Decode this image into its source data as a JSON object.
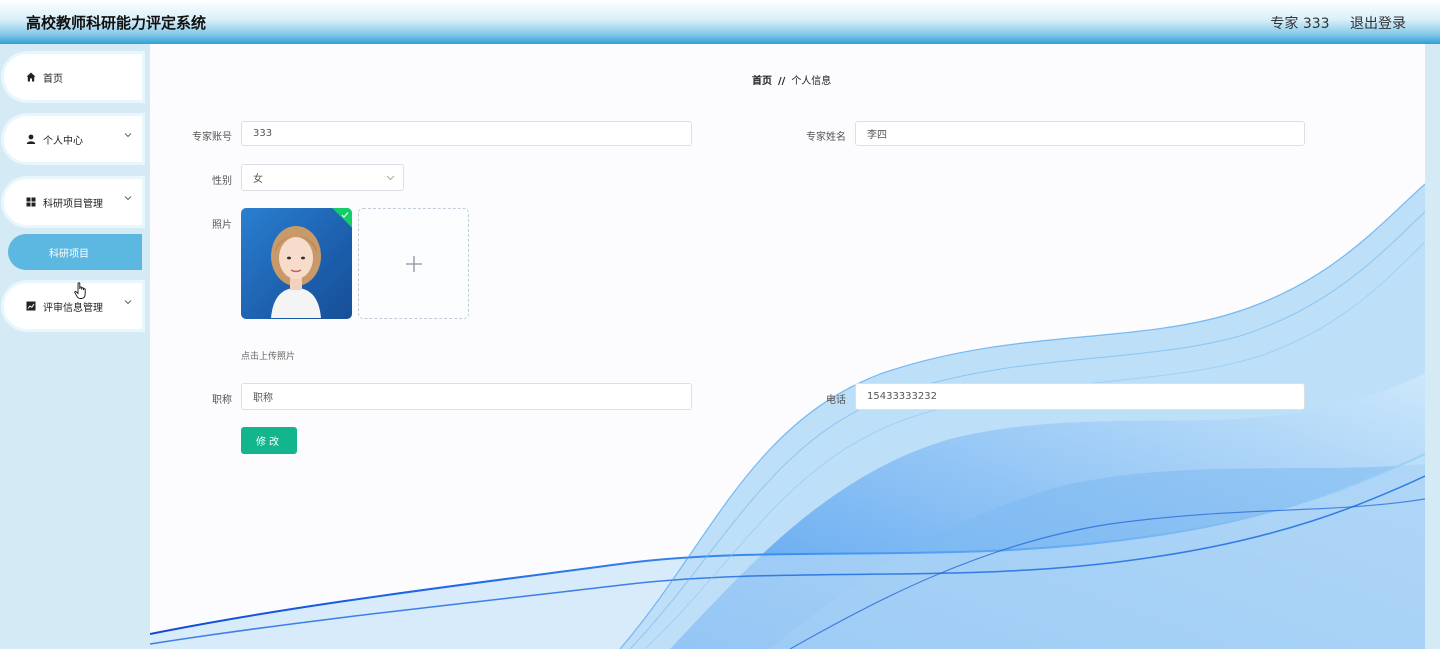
{
  "header": {
    "title": "高校教师科研能力评定系统",
    "user": "专家 333",
    "logout": "退出登录"
  },
  "sidebar": {
    "items": [
      {
        "label": "首页",
        "icon": "home-icon"
      },
      {
        "label": "个人中心",
        "icon": "user-icon"
      },
      {
        "label": "科研项目管理",
        "icon": "grid-icon"
      },
      {
        "label": "评审信息管理",
        "icon": "chart-icon"
      }
    ],
    "submenu": {
      "label": "科研项目"
    }
  },
  "breadcrumb": {
    "home": "首页",
    "separator": "//",
    "current": "个人信息"
  },
  "form": {
    "account_label": "专家账号",
    "account_value": "333",
    "name_label": "专家姓名",
    "name_value": "李四",
    "gender_label": "性别",
    "gender_value": "女",
    "photo_label": "照片",
    "upload_tip": "点击上传照片",
    "title_label": "职称",
    "title_placeholder": "职称",
    "phone_label": "电话",
    "phone_value": "15433333232",
    "submit_label": "修改"
  },
  "colors": {
    "accent": "#13b58c",
    "sidebar_bg": "#d4eaf5",
    "active_menu": "#5cb8e0"
  }
}
